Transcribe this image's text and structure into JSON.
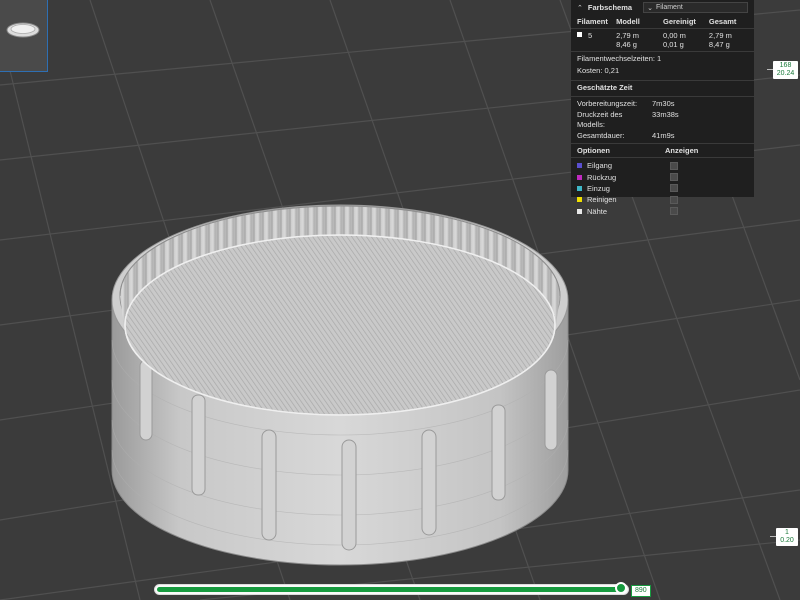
{
  "legend": {
    "title": "Farbschema",
    "scheme_value": "Filament",
    "columns": [
      "Filament",
      "Modell",
      "Gereinigt",
      "Gesamt"
    ],
    "filament": {
      "id": "5",
      "model_length": "2,79 m",
      "model_weight": "8,46 g",
      "purged_length": "0,00 m",
      "purged_weight": "0,01 g",
      "total_length": "2,79 m",
      "total_weight": "8,47 g",
      "color": "#ffffff"
    },
    "changes_label": "Filamentwechselzeiten:",
    "changes_value": "1",
    "cost_label": "Kosten:",
    "cost_value": "0,21",
    "time_section": "Geschätzte Zeit",
    "times": [
      {
        "label": "Vorbereitungszeit:",
        "value": "7m30s"
      },
      {
        "label": "Druckzeit des Modells:",
        "value": "33m38s"
      },
      {
        "label": "Gesamtdauer:",
        "value": "41m9s"
      }
    ],
    "options_header": "Optionen",
    "show_header": "Anzeigen",
    "options": [
      {
        "label": "Eilgang",
        "color": "#5a4fd0"
      },
      {
        "label": "Rückzug",
        "color": "#c02ac0"
      },
      {
        "label": "Einzug",
        "color": "#3fb8c8"
      },
      {
        "label": "Reinigen",
        "color": "#f0e000"
      },
      {
        "label": "Nähte",
        "color": "#e8e8e8"
      }
    ]
  },
  "layer_slider": {
    "top_layer": "168",
    "top_height": "20.24",
    "bottom_layer": "1",
    "bottom_height": "0.20"
  },
  "move_slider": {
    "value": "890",
    "progress": 0.985
  }
}
